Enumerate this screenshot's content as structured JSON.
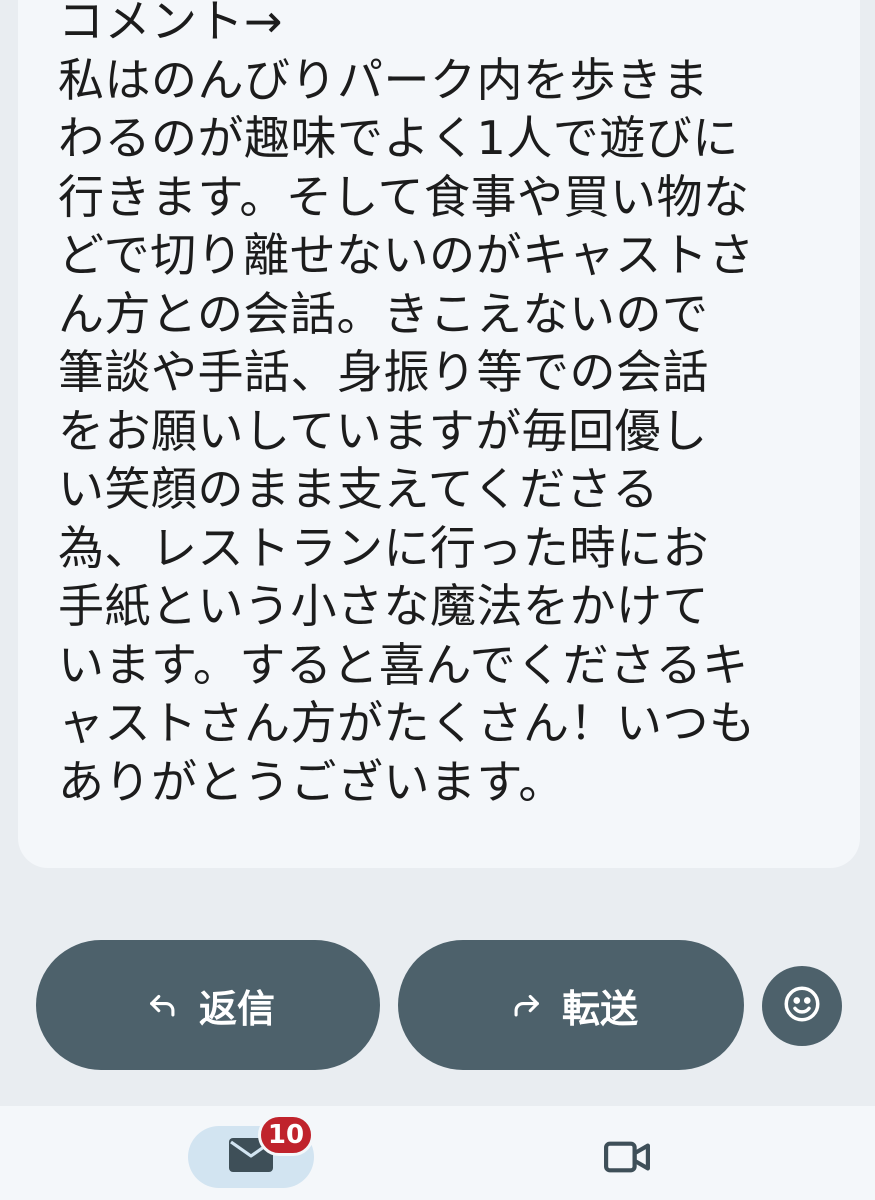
{
  "message": {
    "lines": [
      "コメント→",
      "私はのんびりパーク内を歩きま",
      "わるのが趣味でよく1人で遊びに",
      "行きます。そして食事や買い物な",
      "どで切り離せないのがキャストさ",
      "ん方との会話。きこえないので",
      "筆談や手話、身振り等での会話",
      "をお願いしていますが毎回優し",
      "い笑顔のまま支えてくださる",
      "為、レストランに行った時にお",
      "手紙という小さな魔法をかけて",
      "います。すると喜んでくださるキ",
      "ャストさん方がたくさん！いつも",
      "ありがとうございます。"
    ]
  },
  "actions": {
    "reply": {
      "label": "返信",
      "icon": "reply-arrow-icon"
    },
    "forward": {
      "label": "転送",
      "icon": "forward-arrow-icon"
    },
    "emoji": {
      "icon": "smiley-icon"
    }
  },
  "nav": {
    "mail": {
      "icon": "mail-icon",
      "badge": "10"
    },
    "video": {
      "icon": "video-camera-icon"
    }
  },
  "colors": {
    "button_bg": "#4d616b",
    "badge_bg": "#c0232c",
    "nav_active_bg": "#d2e4f1",
    "card_bg": "#f4f7fa",
    "page_bg": "#e9edf1"
  }
}
